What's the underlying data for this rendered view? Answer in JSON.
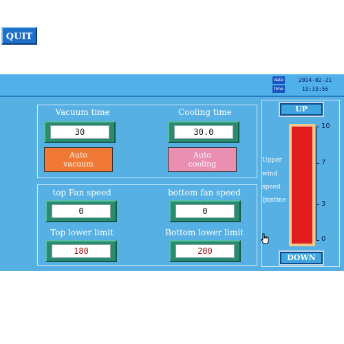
{
  "header": {
    "date_label": "date",
    "date_value": "2014-02-21",
    "time_label": "time",
    "time_value": "19:33:56"
  },
  "quit_label": "QUIT",
  "vacuum": {
    "label": "Vacuum time",
    "value": "30",
    "auto_line1": "Auto",
    "auto_line2": "vacuum"
  },
  "cooling": {
    "label": "Cooling time",
    "value": "30.0",
    "auto_line1": "Auto",
    "auto_line2": "cooling"
  },
  "fans": {
    "top_label": "top Fan speed",
    "top_value": "0",
    "bottom_label": "bottom fan speed",
    "bottom_value": "0",
    "top_lower_label": "Top lower limit",
    "top_lower_value": "180",
    "bottom_lower_label": "Bottom lower limit",
    "bottom_lower_value": "200"
  },
  "wind": {
    "up_label": "UP",
    "down_label": "DOWN",
    "side_labels": [
      "Upper",
      "wind",
      "speed",
      "ljuntme"
    ],
    "ticks": [
      "10",
      "7",
      "3",
      "0"
    ],
    "level": 1.0
  },
  "colors": {
    "background": "#56b0e4",
    "auto_vacuum": "#f07a35",
    "auto_cooling": "#ea8fb1",
    "gauge_fill": "#e01c1c",
    "gauge_frame": "#f2c98a"
  }
}
